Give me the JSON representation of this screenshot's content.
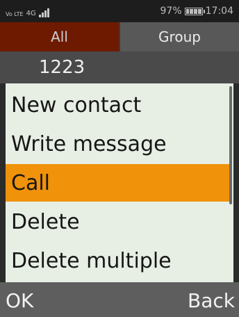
{
  "status_bar": {
    "volte_label": "Vo LTE",
    "network_label": "4G",
    "signal_icon": "signal-bars-icon",
    "battery_percent": "97%",
    "battery_icon": "battery-icon",
    "time": "17:04"
  },
  "tabs": [
    {
      "label": "All",
      "selected": true
    },
    {
      "label": "Group",
      "selected": false
    }
  ],
  "search": {
    "value": "1223"
  },
  "menu": {
    "items": [
      {
        "label": "New contact"
      },
      {
        "label": "Write message"
      },
      {
        "label": "Call"
      },
      {
        "label": "Delete"
      },
      {
        "label": "Delete multiple"
      }
    ],
    "selected_index": 2
  },
  "softkeys": {
    "left": "OK",
    "right": "Back"
  },
  "colors": {
    "selected_tab": "#6e1a00",
    "highlight": "#f0920a",
    "menu_bg": "#e7efe5"
  }
}
